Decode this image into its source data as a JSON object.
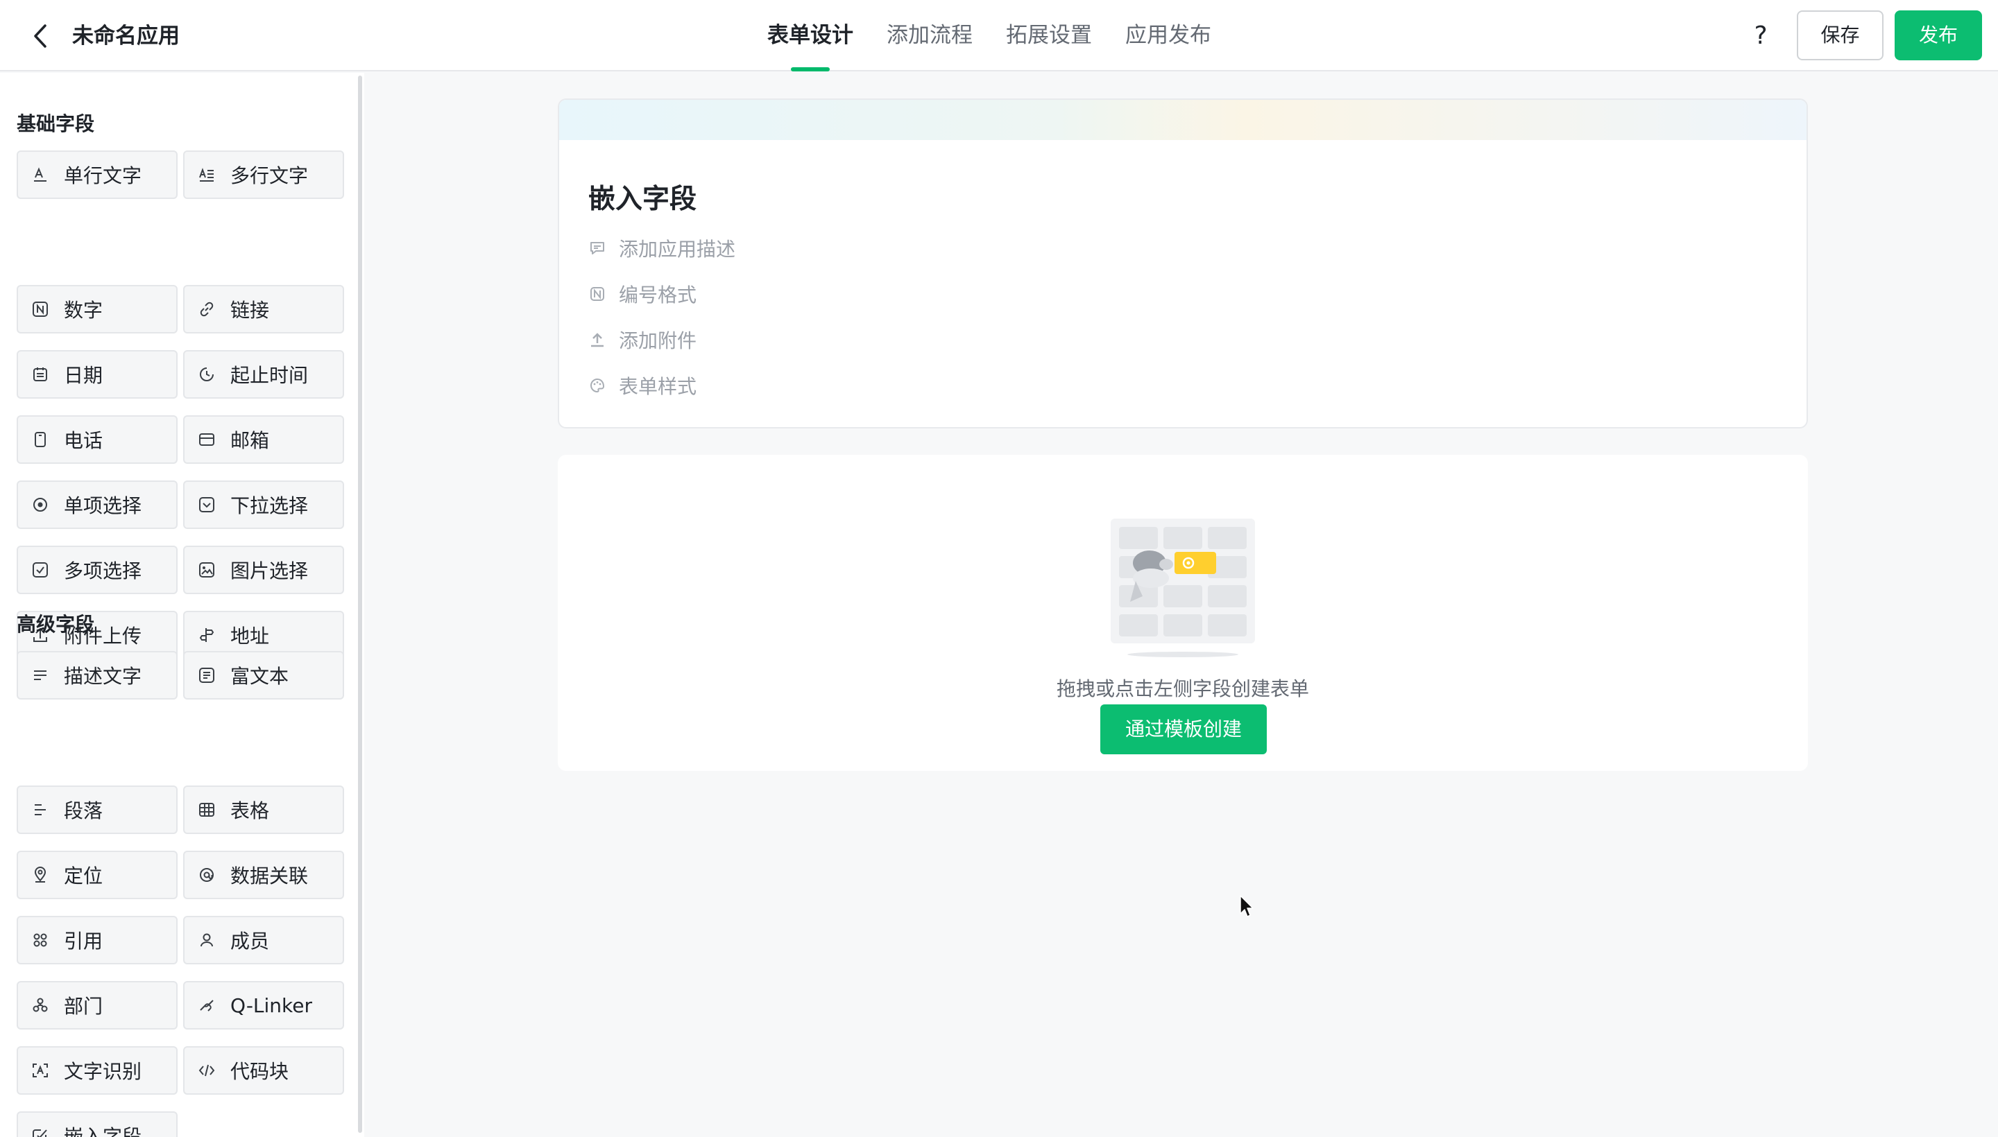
{
  "header": {
    "app_title": "未命名应用",
    "tabs": [
      {
        "label": "表单设计",
        "active": true
      },
      {
        "label": "添加流程",
        "active": false
      },
      {
        "label": "拓展设置",
        "active": false
      },
      {
        "label": "应用发布",
        "active": false
      }
    ],
    "help_label": "?",
    "save_label": "保存",
    "publish_label": "发布"
  },
  "sidebar": {
    "basic_title": "基础字段",
    "basic_fields": [
      {
        "label": "单行文字",
        "icon": "single-line-text-icon"
      },
      {
        "label": "多行文字",
        "icon": "multi-line-text-icon"
      },
      {
        "label": "数字",
        "icon": "number-icon"
      },
      {
        "label": "链接",
        "icon": "link-icon"
      },
      {
        "label": "日期",
        "icon": "calendar-icon"
      },
      {
        "label": "起止时间",
        "icon": "time-range-icon"
      },
      {
        "label": "电话",
        "icon": "phone-icon"
      },
      {
        "label": "邮箱",
        "icon": "mail-icon"
      },
      {
        "label": "单项选择",
        "icon": "radio-icon"
      },
      {
        "label": "下拉选择",
        "icon": "dropdown-icon"
      },
      {
        "label": "多项选择",
        "icon": "checkbox-icon"
      },
      {
        "label": "图片选择",
        "icon": "image-icon"
      },
      {
        "label": "附件上传",
        "icon": "upload-icon"
      },
      {
        "label": "地址",
        "icon": "address-icon"
      }
    ],
    "advanced_title": "高级字段",
    "advanced_fields": [
      {
        "label": "描述文字",
        "icon": "description-icon"
      },
      {
        "label": "富文本",
        "icon": "rich-text-icon"
      },
      {
        "label": "段落",
        "icon": "paragraph-icon"
      },
      {
        "label": "表格",
        "icon": "table-icon"
      },
      {
        "label": "定位",
        "icon": "location-icon"
      },
      {
        "label": "数据关联",
        "icon": "data-link-icon"
      },
      {
        "label": "引用",
        "icon": "reference-icon"
      },
      {
        "label": "成员",
        "icon": "member-icon"
      },
      {
        "label": "部门",
        "icon": "department-icon"
      },
      {
        "label": "Q-Linker",
        "icon": "q-linker-icon"
      },
      {
        "label": "文字识别",
        "icon": "ocr-icon"
      },
      {
        "label": "代码块",
        "icon": "code-icon"
      },
      {
        "label": "嵌入字段",
        "icon": "embed-icon"
      }
    ]
  },
  "form": {
    "title": "嵌入字段",
    "options": [
      {
        "label": "添加应用描述",
        "icon": "comment-icon"
      },
      {
        "label": "编号格式",
        "icon": "number-format-icon"
      },
      {
        "label": "添加附件",
        "icon": "upload-icon"
      },
      {
        "label": "表单样式",
        "icon": "palette-icon"
      }
    ]
  },
  "empty_state": {
    "hint": "拖拽或点击左侧字段创建表单",
    "template_button": "通过模板创建"
  },
  "colors": {
    "accent": "#0cbd71",
    "text_primary": "#1f2329",
    "text_secondary": "#646a73",
    "text_muted": "#9ba0a8"
  }
}
